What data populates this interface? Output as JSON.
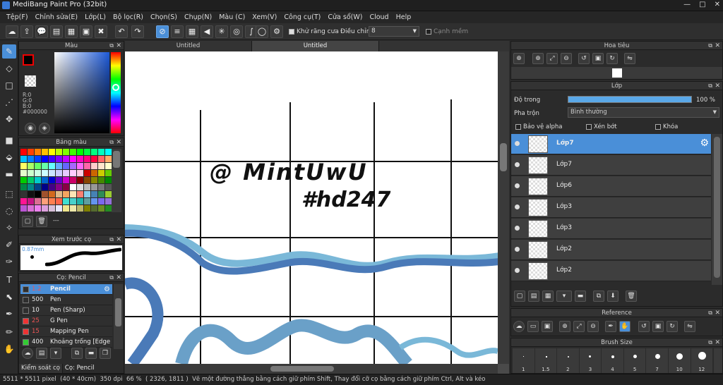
{
  "window": {
    "title": "MediBang Paint Pro (32bit)",
    "min": "—",
    "max": "□",
    "close": "✕"
  },
  "menu": [
    "Tệp(F)",
    "Chỉnh sửa(E)",
    "Lớp(L)",
    "Bộ lọc(R)",
    "Chọn(S)",
    "Chụp(N)",
    "Màu (C)",
    "Xem(V)",
    "Công cụ(T)",
    "Cửa sổ(W)",
    "Cloud",
    "Help"
  ],
  "toolbar": {
    "antialias_label": "Khử răng cưa",
    "adjust_label": "Điều chỉnh",
    "adjust_value": "8",
    "snap_label": "Cạnh mềm"
  },
  "panels": {
    "color": {
      "title": "Màu",
      "r": "R:0",
      "g": "G:0",
      "b": "B:0",
      "hex": "#000000"
    },
    "palette": {
      "title": "Bảng màu",
      "footer": "---"
    },
    "preview": {
      "title": "Xem trước cọ",
      "size": "0.87mm"
    },
    "brush": {
      "title": "Cọ: Pencil",
      "items": [
        {
          "size": "1.2",
          "name": "Pencil"
        },
        {
          "size": "500",
          "name": "Pen"
        },
        {
          "size": "10",
          "name": "Pen (Sharp)"
        },
        {
          "size": "25",
          "name": "G Pen"
        },
        {
          "size": "15",
          "name": "Mapping Pen"
        },
        {
          "size": "400",
          "name": "Khoảng trống [Edge"
        }
      ],
      "tabs": [
        "Kiểm soát cọ",
        "Cọ: Pencil"
      ]
    },
    "navigator": {
      "title": "Hoa tiêu"
    },
    "layers": {
      "title": "Lớp",
      "opacity_label": "Độ trong",
      "opacity_value": "100 %",
      "blend_label": "Pha trộn",
      "blend_value": "Bình thường",
      "protect_alpha": "Bảo vệ alpha",
      "clipping": "Xén bớt",
      "lock": "Khóa",
      "items": [
        "Lớp7",
        "Lớp7",
        "Lớp6",
        "Lớp3",
        "Lớp3",
        "Lớp2",
        "Lớp2"
      ]
    },
    "reference": {
      "title": "Reference"
    },
    "brushsize": {
      "title": "Brush Size",
      "sizes": [
        "1",
        "1.5",
        "2",
        "3",
        "4",
        "5",
        "7",
        "10",
        "12"
      ]
    }
  },
  "doc_tabs": [
    "Untitled",
    "Untitled"
  ],
  "canvas_text": {
    "line1": "@ MintUwU",
    "line2": "#hd247"
  },
  "status": {
    "size": "5511 * 5511 pixel",
    "cm": "(40 * 40cm)",
    "dpi": "350 dpi",
    "zoom": "66 %",
    "coords": "( 2326, 1811 )",
    "hint": "Vẽ một đường thẳng bằng cách giữ phím Shift, Thay đổi cỡ cọ bằng cách giữ phím Ctrl, Alt và kéo"
  },
  "colors": {
    "accent": "#4a8fd8",
    "wave_dark": "#4a7ab8",
    "wave_light": "#7ab8d8"
  }
}
